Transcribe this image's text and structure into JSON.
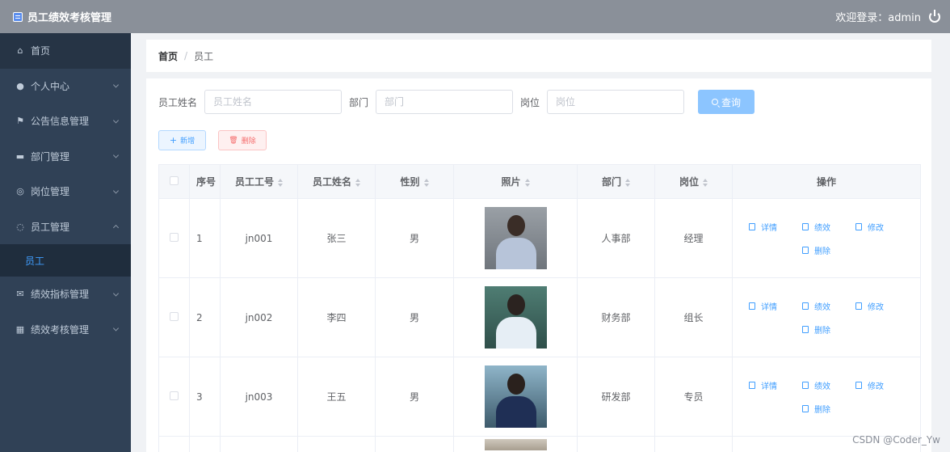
{
  "header": {
    "title": "员工绩效考核管理",
    "welcome": "欢迎登录：admin"
  },
  "sidebar": {
    "items": [
      {
        "label": "首页",
        "icon": "home-icon",
        "has_arrow": false
      },
      {
        "label": "个人中心",
        "icon": "user-icon",
        "has_arrow": true
      },
      {
        "label": "公告信息管理",
        "icon": "flag-icon",
        "has_arrow": true
      },
      {
        "label": "部门管理",
        "icon": "chat-icon",
        "has_arrow": true
      },
      {
        "label": "岗位管理",
        "icon": "compass-icon",
        "has_arrow": true
      },
      {
        "label": "员工管理",
        "icon": "loading-icon",
        "has_arrow": true,
        "expanded": true
      },
      {
        "label": "绩效指标管理",
        "icon": "mail-icon",
        "has_arrow": true
      },
      {
        "label": "绩效考核管理",
        "icon": "grid-icon",
        "has_arrow": true
      }
    ],
    "submenu": {
      "label": "员工"
    }
  },
  "breadcrumb": {
    "home": "首页",
    "separator": "/",
    "current": "员工"
  },
  "search": {
    "name_label": "员工姓名",
    "name_placeholder": "员工姓名",
    "dept_label": "部门",
    "dept_placeholder": "部门",
    "post_label": "岗位",
    "post_placeholder": "岗位",
    "query_label": "查询"
  },
  "actions": {
    "add_label": "新增",
    "delete_label": "删除"
  },
  "table": {
    "headers": [
      "序号",
      "员工工号",
      "员工姓名",
      "性别",
      "照片",
      "部门",
      "岗位",
      "操作"
    ],
    "rows": [
      {
        "index": "1",
        "emp_no": "jn001",
        "name": "张三",
        "gender": "男",
        "department": "人事部",
        "post": "经理"
      },
      {
        "index": "2",
        "emp_no": "jn002",
        "name": "李四",
        "gender": "男",
        "department": "财务部",
        "post": "组长"
      },
      {
        "index": "3",
        "emp_no": "jn003",
        "name": "王五",
        "gender": "男",
        "department": "研发部",
        "post": "专员"
      }
    ],
    "ops": {
      "detail": "详情",
      "perf": "绩效",
      "edit": "修改",
      "delete": "删除"
    }
  },
  "watermark": "CSDN @Coder_Yw",
  "colors": {
    "sidebar_bg": "#304156",
    "header_bg": "#8a9099",
    "accent": "#409eff",
    "danger": "#f56c6c"
  }
}
